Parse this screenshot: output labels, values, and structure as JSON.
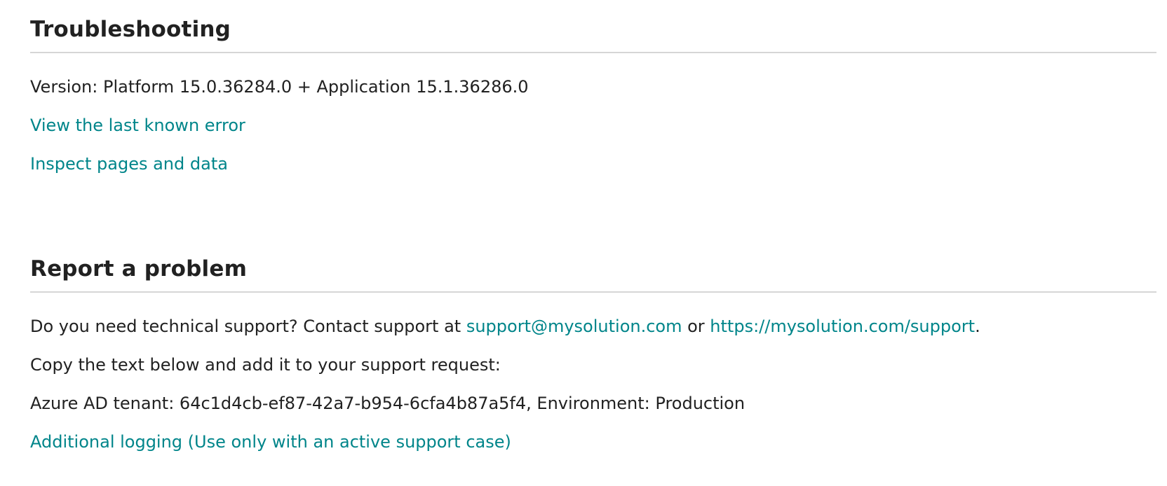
{
  "troubleshooting": {
    "title": "Troubleshooting",
    "version_text": "Version: Platform 15.0.36284.0 + Application 15.1.36286.0",
    "view_error_link": "View the last known error",
    "inspect_link": "Inspect pages and data"
  },
  "report": {
    "title": "Report a problem",
    "support_prefix": "Do you need technical support? Contact support at ",
    "support_email": "support@mysolution.com",
    "support_or": " or ",
    "support_url": "https://mysolution.com/support",
    "support_suffix": ".",
    "copy_instruction": "Copy the text below and add it to your support request:",
    "tenant_info": "Azure AD tenant: 64c1d4cb-ef87-42a7-b954-6cfa4b87a5f4, Environment: Production",
    "logging_link": "Additional logging (Use only with an active support case)"
  },
  "colors": {
    "link": "#00858a",
    "text": "#212121",
    "divider": "#d6d6d6"
  }
}
